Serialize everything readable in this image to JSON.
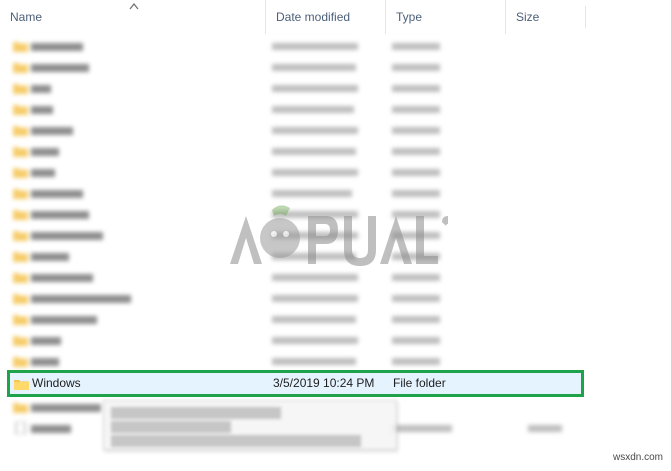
{
  "header": {
    "name": "Name",
    "date_modified": "Date modified",
    "type": "Type",
    "size": "Size"
  },
  "selected_row": {
    "name": "Windows",
    "date_modified": "3/5/2019 10:24 PM",
    "type": "File folder"
  },
  "watermark_text": "APPUALS",
  "site_label": "wsxdn.com",
  "colors": {
    "selection_border": "#1ea24a",
    "selection_fill": "#e5f3ff",
    "folder": "#f5c451",
    "header_text": "#4c607a"
  }
}
